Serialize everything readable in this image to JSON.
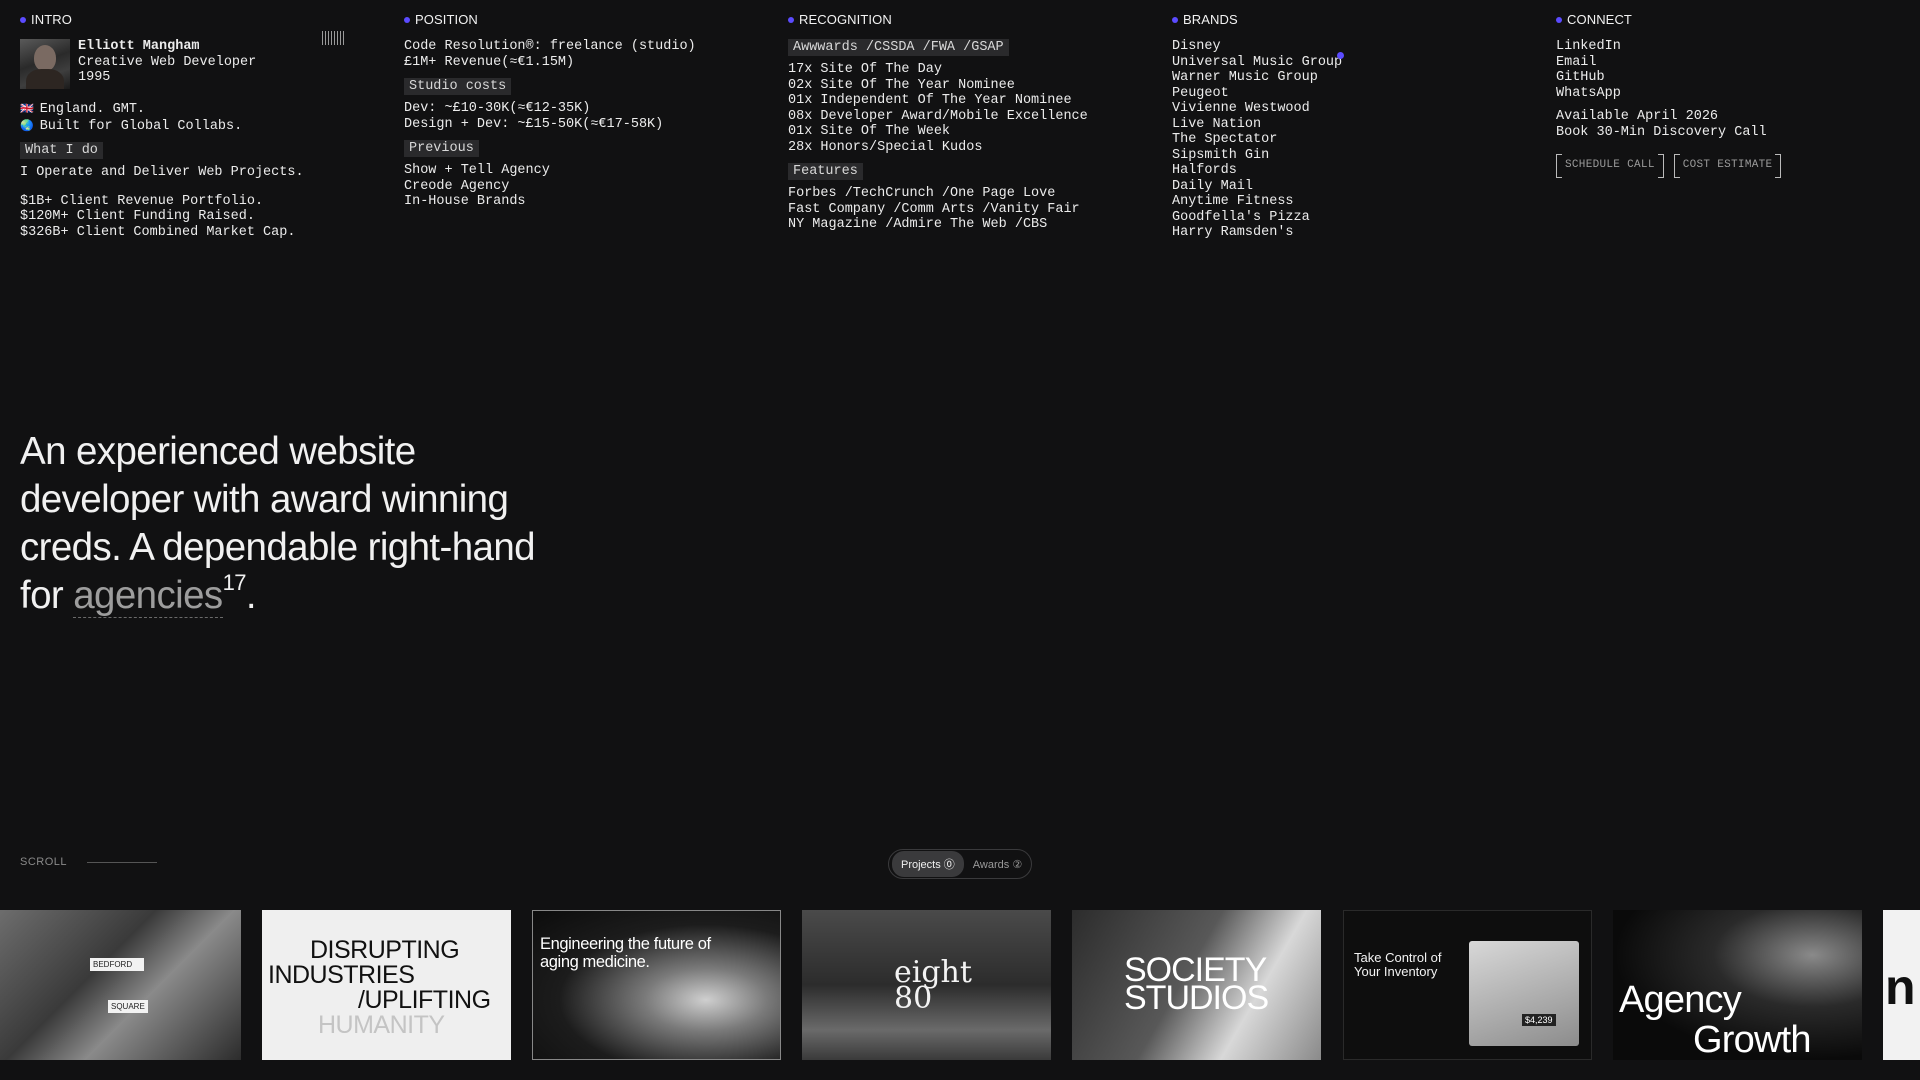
{
  "intro": {
    "heading": "INTRO",
    "name": "Elliott Mangham",
    "role": "Creative Web Developer",
    "year": "1995",
    "location": "England. GMT.",
    "location_flag": "🇬🇧",
    "global": "Built for Global Collabs.",
    "global_icon": "🌏",
    "what_tag": "What I do",
    "what_text": "I Operate and Deliver Web Projects.",
    "stats": [
      "$1B+ Client Revenue Portfolio.",
      "$120M+ Client Funding Raised.",
      "$326B+ Client Combined Market Cap."
    ]
  },
  "position": {
    "heading": "POSITION",
    "line1": "Code Resolution®: freelance (studio)",
    "line2": "£1M+ Revenue(≈€1.15M)",
    "costs_tag": "Studio costs",
    "costs": [
      "Dev: ~£10-30K(≈€12-35K)",
      "Design + Dev: ~£15-50K(≈€17-58K)"
    ],
    "previous_tag": "Previous",
    "previous": [
      "Show + Tell Agency",
      "Creode Agency",
      "In-House Brands"
    ]
  },
  "recognition": {
    "heading": "RECOGNITION",
    "awards_tag": "Awwwards /CSSDA /FWA /GSAP",
    "awards": [
      "17x Site Of The Day",
      "02x Site Of The Year Nominee",
      "01x Independent Of The Year Nominee",
      "08x Developer Award/Mobile Excellence",
      "01x Site Of The Week",
      "28x Honors/Special Kudos"
    ],
    "features_tag": "Features",
    "features": [
      "Forbes /TechCrunch /One Page Love",
      "Fast Company /Comm Arts /Vanity Fair",
      "NY Magazine /Admire The Web /CBS"
    ]
  },
  "brands": {
    "heading": "BRANDS",
    "items": [
      "Disney",
      "Universal Music Group",
      "Warner Music Group",
      "Peugeot",
      "Vivienne Westwood",
      "Live Nation",
      "The Spectator",
      "Sipsmith Gin",
      "Halfords",
      "Daily Mail",
      "Anytime Fitness",
      "Goodfella's Pizza",
      "Harry Ramsden's"
    ]
  },
  "connect": {
    "heading": "CONNECT",
    "links": [
      "LinkedIn",
      "Email",
      "GitHub",
      "WhatsApp"
    ],
    "available": "Available April 2026",
    "discovery": "Book 30-Min Discovery Call",
    "schedule_btn": "SCHEDULE CALL",
    "estimate_btn": "COST ESTIMATE"
  },
  "hero": {
    "text_before": "An experienced website developer with award winning creds. A dependable right-hand for ",
    "accent": "agencies",
    "sup": "17",
    "end": "."
  },
  "scroll": {
    "label": "SCROLL"
  },
  "toggle": {
    "projects": "Projects ⓪",
    "awards": "Awards ②"
  },
  "thumbs": {
    "t1_sign1": "BEDFORD",
    "t1_sign2": "SQUARE",
    "t2_line1": "DISRUPTING",
    "t2_line2": "INDUSTRIES",
    "t2_line3": "/UPLIFTING",
    "t2_line4": "HUMANITY",
    "t3_text": "Engineering the future of aging medicine.",
    "t4_text": "eight 80",
    "t5_line1": "SOCIETY",
    "t5_line2": "STUDIOS",
    "t6_text": "Take Control of Your Inventory",
    "t6_price": "$4,239",
    "t7_line1": "Agency",
    "t7_line2": "Growth",
    "t8_text": "n"
  },
  "colors": {
    "accent": "#5b4bff",
    "background": "#111112",
    "tag_bg": "#2a2a2c"
  }
}
